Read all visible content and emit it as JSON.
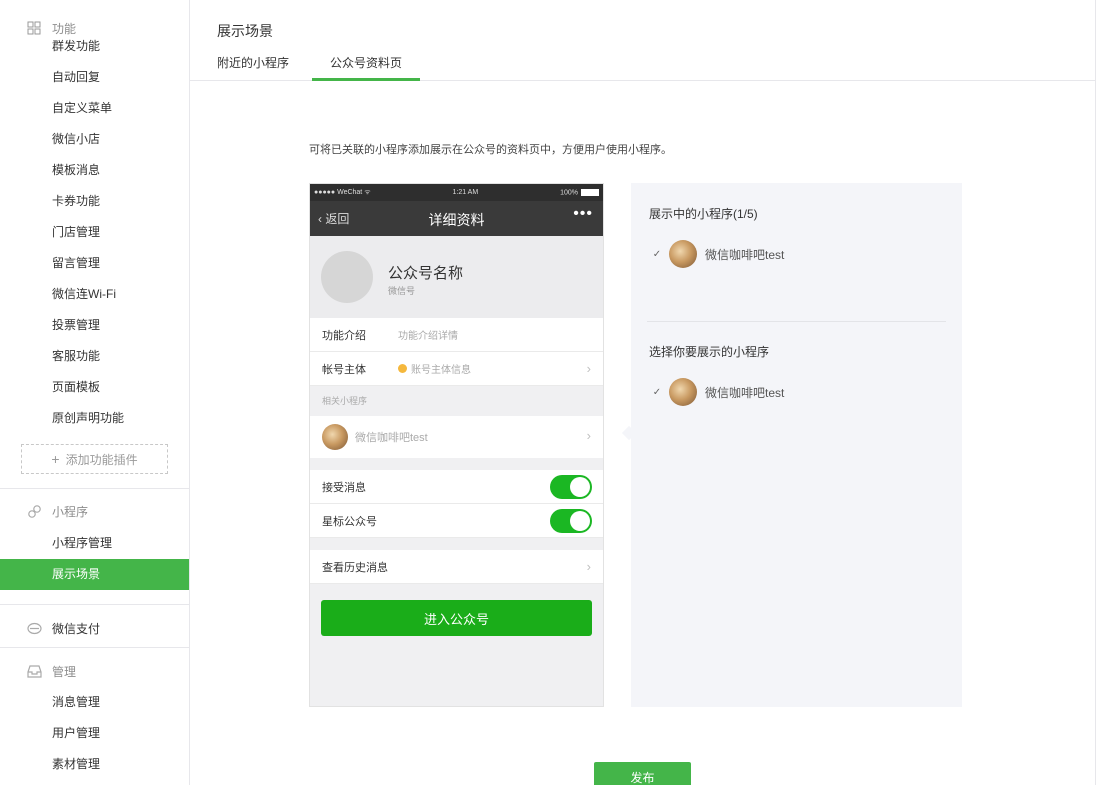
{
  "sidebar": {
    "sections": [
      {
        "title": "功能",
        "icon": "grid-icon",
        "items": [
          "群发功能",
          "自动回复",
          "自定义菜单",
          "微信小店",
          "模板消息",
          "卡券功能",
          "门店管理",
          "留言管理",
          "微信连Wi-Fi",
          "投票管理",
          "客服功能",
          "页面模板",
          "原创声明功能"
        ]
      },
      {
        "title": "小程序",
        "icon": "link-icon",
        "items": [
          "小程序管理",
          "展示场景"
        ]
      },
      {
        "title": "微信支付",
        "icon": "wallet-icon",
        "items": []
      },
      {
        "title": "管理",
        "icon": "inbox-icon",
        "items": [
          "消息管理",
          "用户管理",
          "素材管理"
        ]
      }
    ],
    "add_plugin_label": "添加功能插件",
    "active_item": "展示场景"
  },
  "main": {
    "title": "展示场景",
    "tabs": [
      {
        "label": "附近的小程序",
        "active": false
      },
      {
        "label": "公众号资料页",
        "active": true
      }
    ],
    "description": "可将已关联的小程序添加展示在公众号的资料页中，方便用户使用小程序。",
    "publish_label": "发布"
  },
  "phone": {
    "status_left": "●●●●● WeChat ᯤ",
    "status_time": "1:21 AM",
    "status_battery": "100%",
    "back_label": "返回",
    "title": "详细资料",
    "more": "•••",
    "account_name": "公众号名称",
    "account_id": "微信号",
    "rows": [
      {
        "key": "功能介绍",
        "value": "功能介绍详情"
      },
      {
        "key": "帐号主体",
        "value": "账号主体信息"
      }
    ],
    "related_title": "相关小程序",
    "mini_program_name": "微信咖啡吧test",
    "toggles": [
      {
        "label": "接受消息",
        "on": true
      },
      {
        "label": "星标公众号",
        "on": true
      }
    ],
    "history_label": "查看历史消息",
    "enter_label": "进入公众号"
  },
  "panel": {
    "showing_title": "展示中的小程序(1/5)",
    "showing_items": [
      {
        "name": "微信咖啡吧test",
        "checked": true
      }
    ],
    "choose_title": "选择你要展示的小程序",
    "choose_items": [
      {
        "name": "微信咖啡吧test",
        "checked": true
      }
    ]
  },
  "colors": {
    "accent": "#44b549",
    "wechat_green": "#1aad19",
    "panel_bg": "#f4f5f9"
  }
}
